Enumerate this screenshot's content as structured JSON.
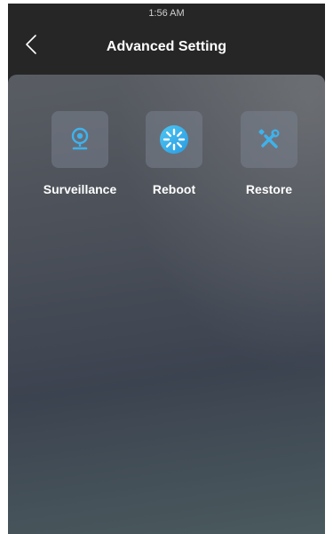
{
  "status_bar": {
    "time": "1:56 AM"
  },
  "header": {
    "title": "Advanced Setting",
    "back_icon": "chevron-left-icon"
  },
  "tiles": [
    {
      "label": "Surveillance",
      "icon": "webcam-icon"
    },
    {
      "label": "Reboot",
      "icon": "reboot-icon"
    },
    {
      "label": "Restore",
      "icon": "tools-icon"
    }
  ],
  "colors": {
    "accent": "#3fb2ec",
    "background": "#262626",
    "panel": "#4a4f58",
    "text": "#ffffff"
  }
}
